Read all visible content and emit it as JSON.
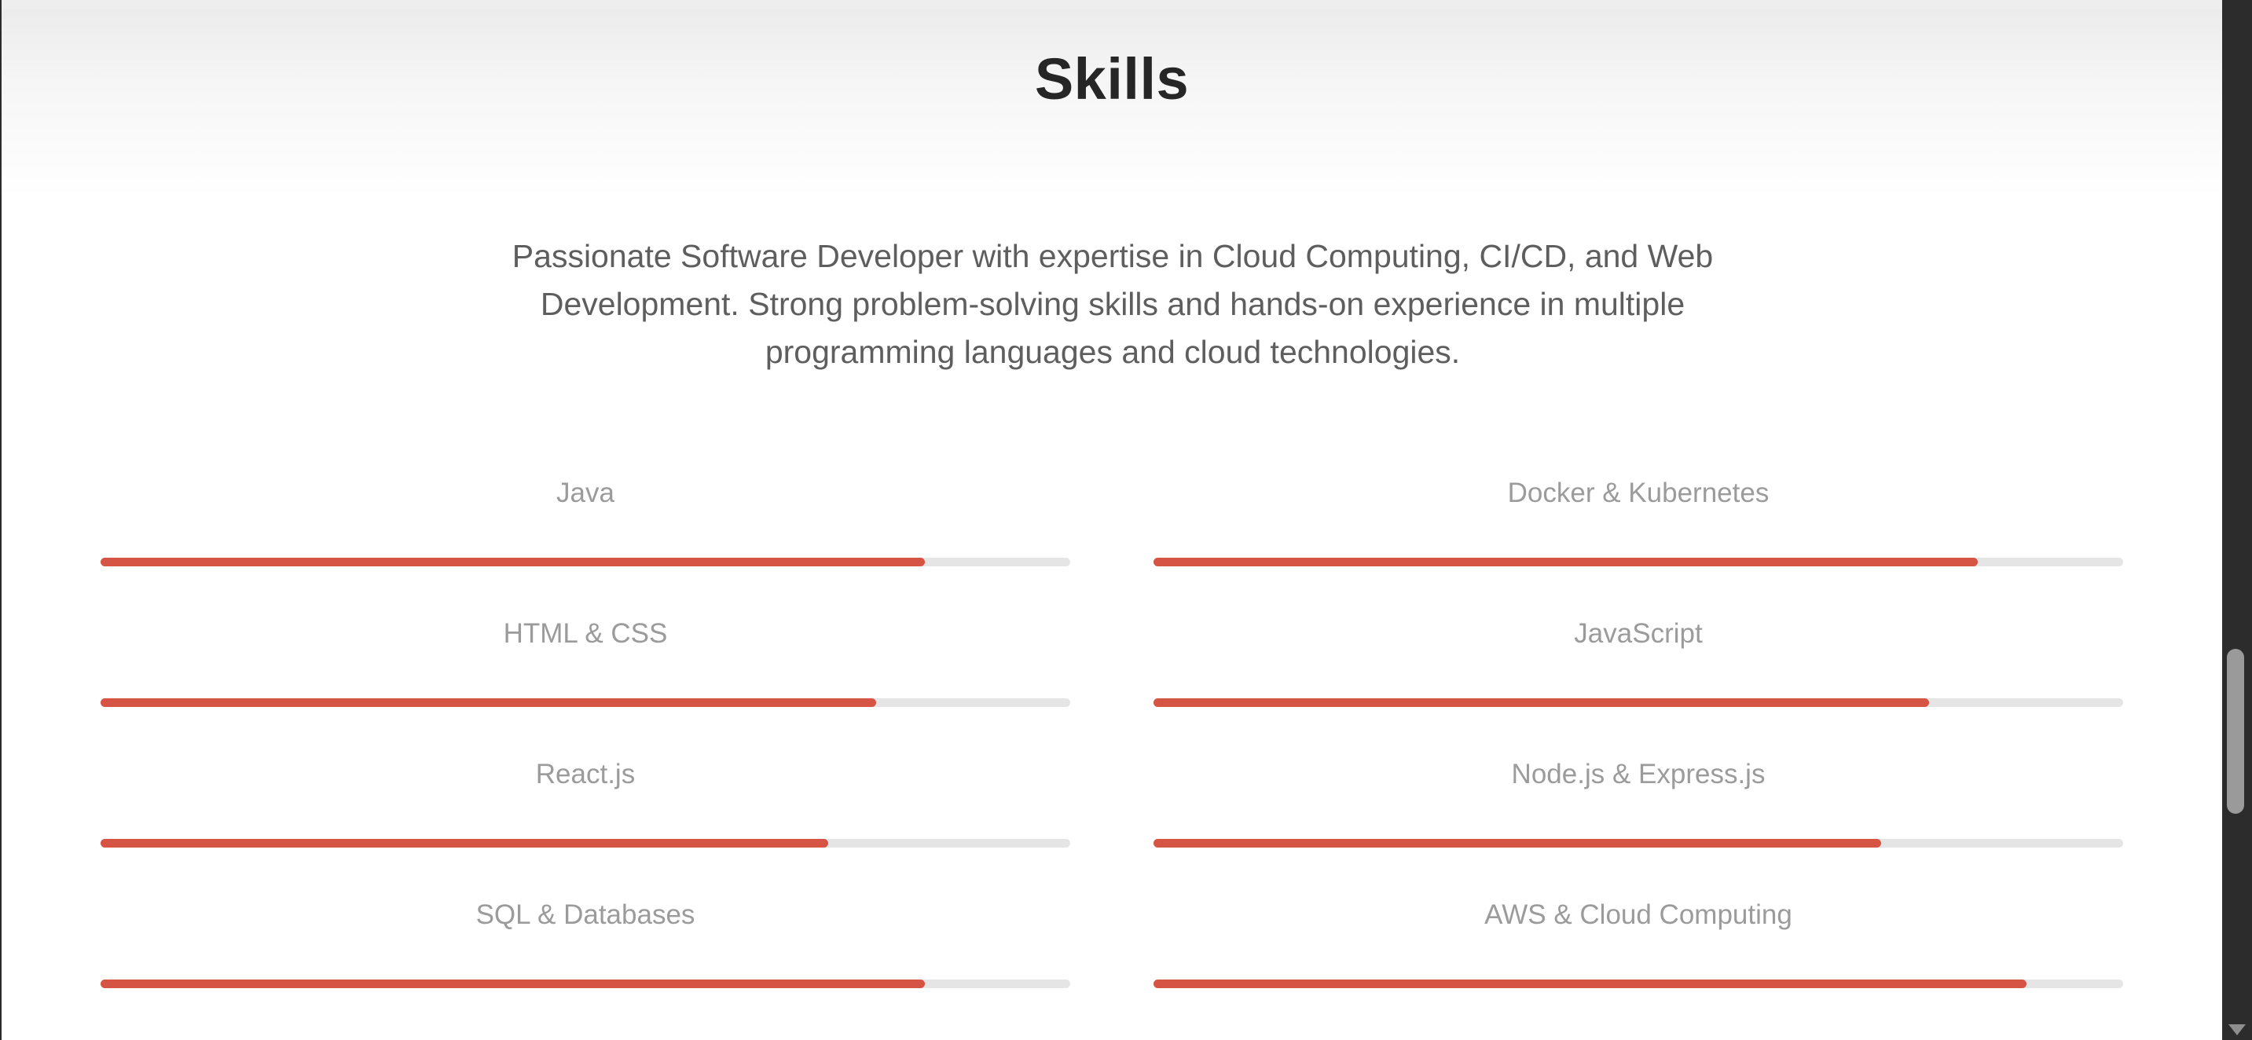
{
  "section": {
    "title": "Skills",
    "intro": "Passionate Software Developer with expertise in Cloud Computing, CI/CD, and Web Development. Strong problem-solving skills and hands-on experience in multiple programming languages and cloud technologies."
  },
  "skills": [
    {
      "name": "Java",
      "level": 85
    },
    {
      "name": "Docker & Kubernetes",
      "level": 85
    },
    {
      "name": "HTML & CSS",
      "level": 80
    },
    {
      "name": "JavaScript",
      "level": 80
    },
    {
      "name": "React.js",
      "level": 75
    },
    {
      "name": "Node.js & Express.js",
      "level": 75
    },
    {
      "name": "SQL & Databases",
      "level": 85
    },
    {
      "name": "AWS & Cloud Computing",
      "level": 90
    }
  ],
  "colors": {
    "accent": "#d65444",
    "track": "#e5e5e5",
    "title": "#262626",
    "text": "#5e5e5e",
    "label": "#9b9b9b"
  }
}
